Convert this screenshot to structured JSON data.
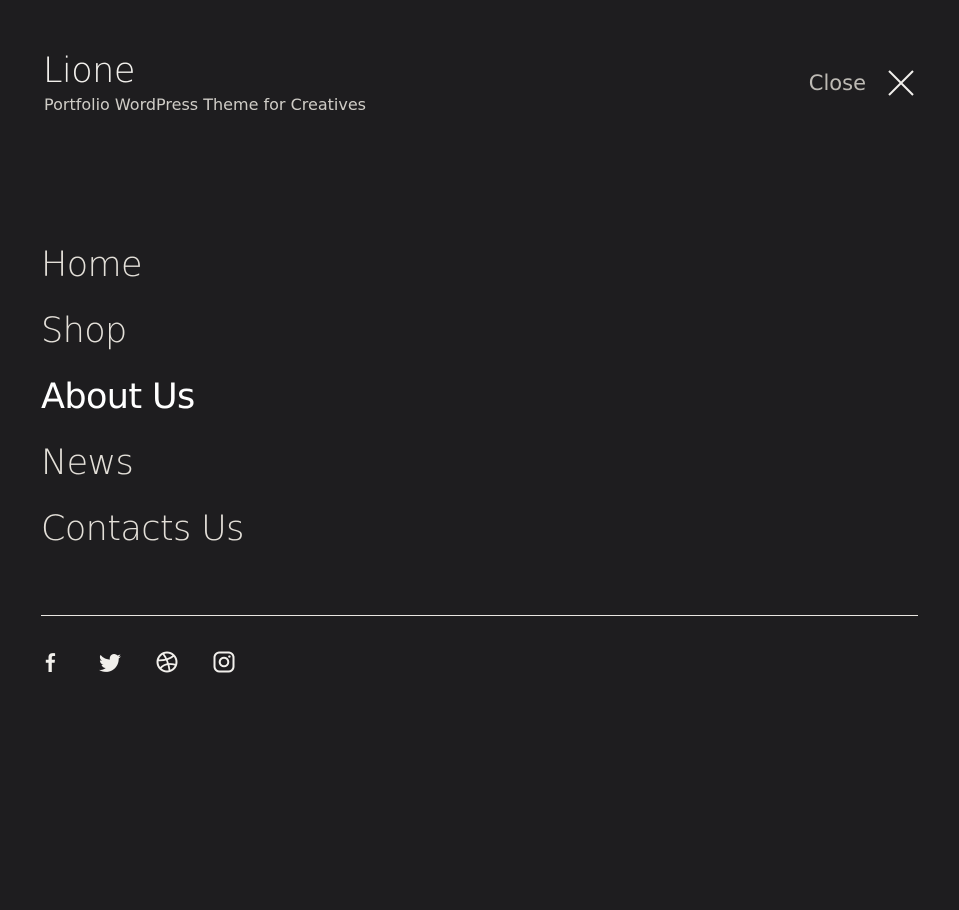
{
  "brand": {
    "title": "Lione",
    "tagline": "Portfolio WordPress Theme for Creatives"
  },
  "close": {
    "label": "Close",
    "icon": "close-icon"
  },
  "menu": {
    "items": [
      {
        "label": "Home",
        "active": false
      },
      {
        "label": "Shop",
        "active": false
      },
      {
        "label": "About Us",
        "active": true
      },
      {
        "label": "News",
        "active": false
      },
      {
        "label": "Contacts Us",
        "active": false
      }
    ]
  },
  "social": {
    "icons": [
      "facebook-icon",
      "twitter-icon",
      "dribbble-icon",
      "instagram-icon"
    ]
  },
  "colors": {
    "background": "#1e1d1f",
    "text": "#e3dfd8",
    "active": "#ffffff",
    "divider": "#e9e6e1"
  }
}
